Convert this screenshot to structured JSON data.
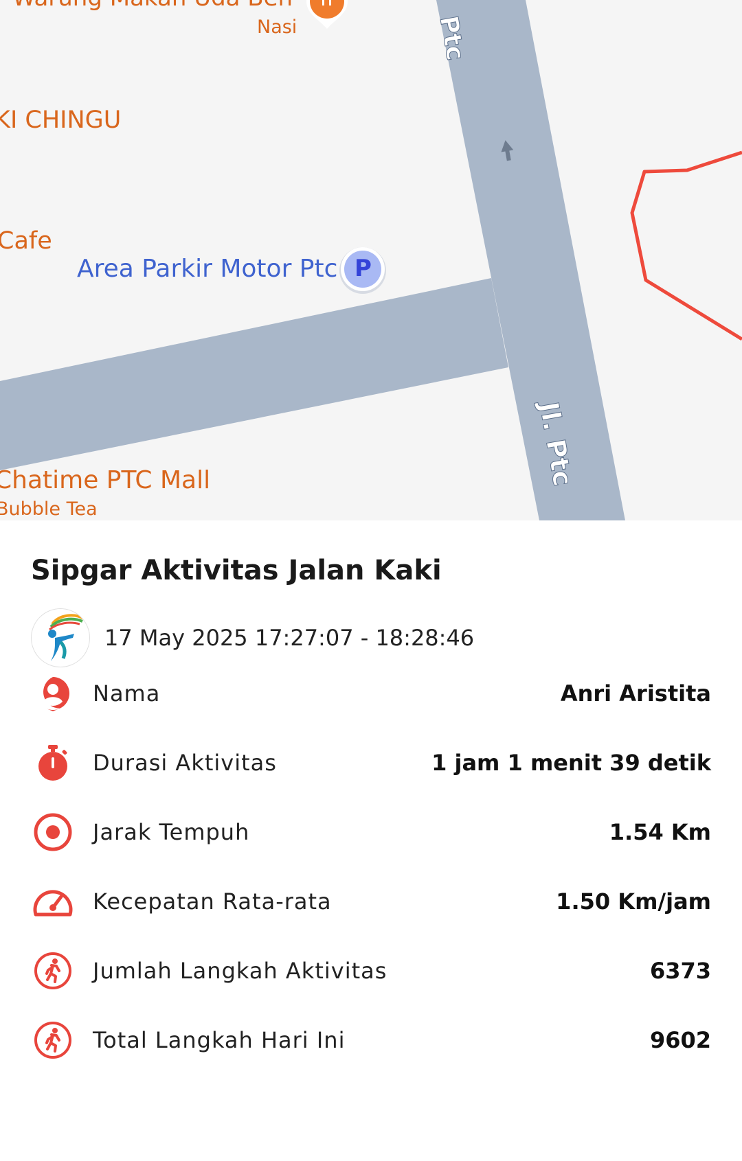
{
  "map": {
    "labels": {
      "warung": "Warung Makan Uda Ben",
      "nasi": "Nasi",
      "chingu": "KI CHINGU",
      "cafe": "Cafe",
      "parkir": "Area Parkir Motor Ptc",
      "parking_symbol": "P",
      "chatime": "Chatime PTC Mall",
      "bubble_tea": "Bubble Tea",
      "road_top": "Ptc",
      "road_bottom": "Jl. Ptc"
    },
    "colors": {
      "road": "#a9b7c9",
      "background": "#f5f5f5",
      "route": "#ee4a3c",
      "poi_text": "#d9661c",
      "parking_text": "#3f63cf"
    }
  },
  "panel": {
    "title": "Sipgar Aktivitas Jalan Kaki",
    "datetime": "17 May 2025 17:27:07 - 18:28:46",
    "accent_color": "#e8453c",
    "stats": [
      {
        "icon": "user-pin-icon",
        "label": "Nama",
        "value": "Anri Aristita"
      },
      {
        "icon": "stopwatch-icon",
        "label": "Durasi Aktivitas",
        "value": "1 jam 1 menit 39 detik"
      },
      {
        "icon": "target-icon",
        "label": "Jarak Tempuh",
        "value": "1.54 Km"
      },
      {
        "icon": "speedometer-icon",
        "label": "Kecepatan Rata-rata",
        "value": "1.50 Km/jam"
      },
      {
        "icon": "walking-icon",
        "label": "Jumlah Langkah Aktivitas",
        "value": "6373"
      },
      {
        "icon": "walking-icon",
        "label": "Total Langkah Hari Ini",
        "value": "9602"
      }
    ]
  }
}
